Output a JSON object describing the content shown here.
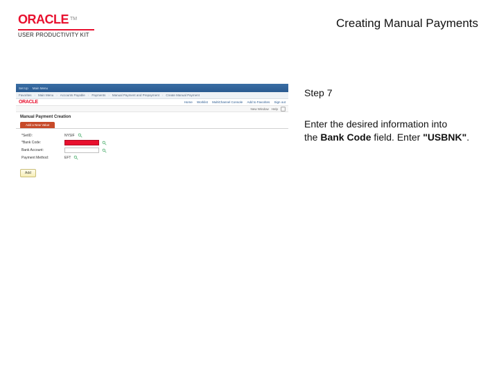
{
  "header": {
    "logo_text": "ORACLE",
    "logo_tm": "TM",
    "logo_subtitle": "USER PRODUCTIVITY KIT",
    "title": "Creating Manual Payments"
  },
  "instruction": {
    "step_label": "Step 7",
    "line1": "Enter the desired information into",
    "line2_prefix": "the ",
    "line2_bold1": "Bank Code",
    "line2_mid": " field. Enter ",
    "line2_bold2": "\"USBNK\"",
    "line2_suffix": "."
  },
  "app": {
    "topbar": {
      "items": [
        "Set Up",
        "Main Menu",
        "Accounts Payable",
        "Payments",
        "Manual Payment and Prepayment",
        "Create Manual Payment"
      ]
    },
    "crumb": {
      "items": [
        "Favorites",
        "Main Menu",
        "Accounts Payable",
        "Payments",
        "Manual Payment and Prepayment",
        "Create Manual Payment"
      ]
    },
    "brand": "ORACLE",
    "links": {
      "home": "Home",
      "worklist": "Worklist",
      "mcc": "MultiChannel Console",
      "addfav": "Add to Favorites",
      "signout": "Sign out"
    },
    "thirdbar": {
      "new_window": "New Window",
      "help": "Help"
    },
    "page_title": "Manual Payment Creation",
    "tab": "Add a New Value",
    "form": {
      "setid_label": "*SetID:",
      "setid_value": "NYSIF",
      "bankcode_label": "*Bank Code:",
      "bankacct_label": "Bank Account:",
      "paymethod_label": "Payment Method:",
      "paymethod_value": "EFT"
    },
    "add_button": "Add"
  }
}
